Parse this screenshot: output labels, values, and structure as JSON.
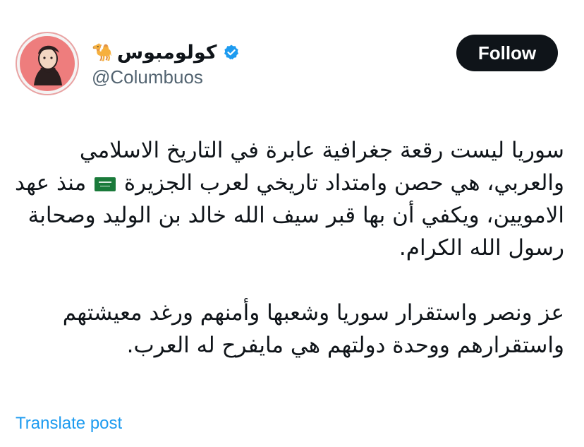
{
  "author": {
    "display_name": "كولومبوس",
    "emoji": "🐪",
    "verified_icon": "verified-badge-icon",
    "handle": "@Columbuos",
    "avatar_icon": "avatar-portrait"
  },
  "actions": {
    "follow_label": "Follow",
    "translate_label": "Translate post"
  },
  "post": {
    "para1_before_flag": "سوريا ليست رقعة جغرافية عابرة في التاريخ الاسلامي والعربي، هي حصن وامتداد تاريخي لعرب الجزيرة ",
    "flag_icon": "saudi-flag-icon",
    "para1_after_flag": " منذ عهد الامويين، ويكفي أن بها قبر سيف الله خالد بن الوليد وصحابة رسول الله الكرام.",
    "para2": "عز ونصر واستقرار سوريا وشعبها وأمنهم ورغد معيشتهم واستقرارهم ووحدة دولتهم هي مايفرح له العرب."
  },
  "colors": {
    "follow_bg": "#0f1419",
    "link": "#1d9bf0",
    "handle": "#536471",
    "verified": "#1d9bf0",
    "avatar_bg": "#ee7d7d"
  }
}
